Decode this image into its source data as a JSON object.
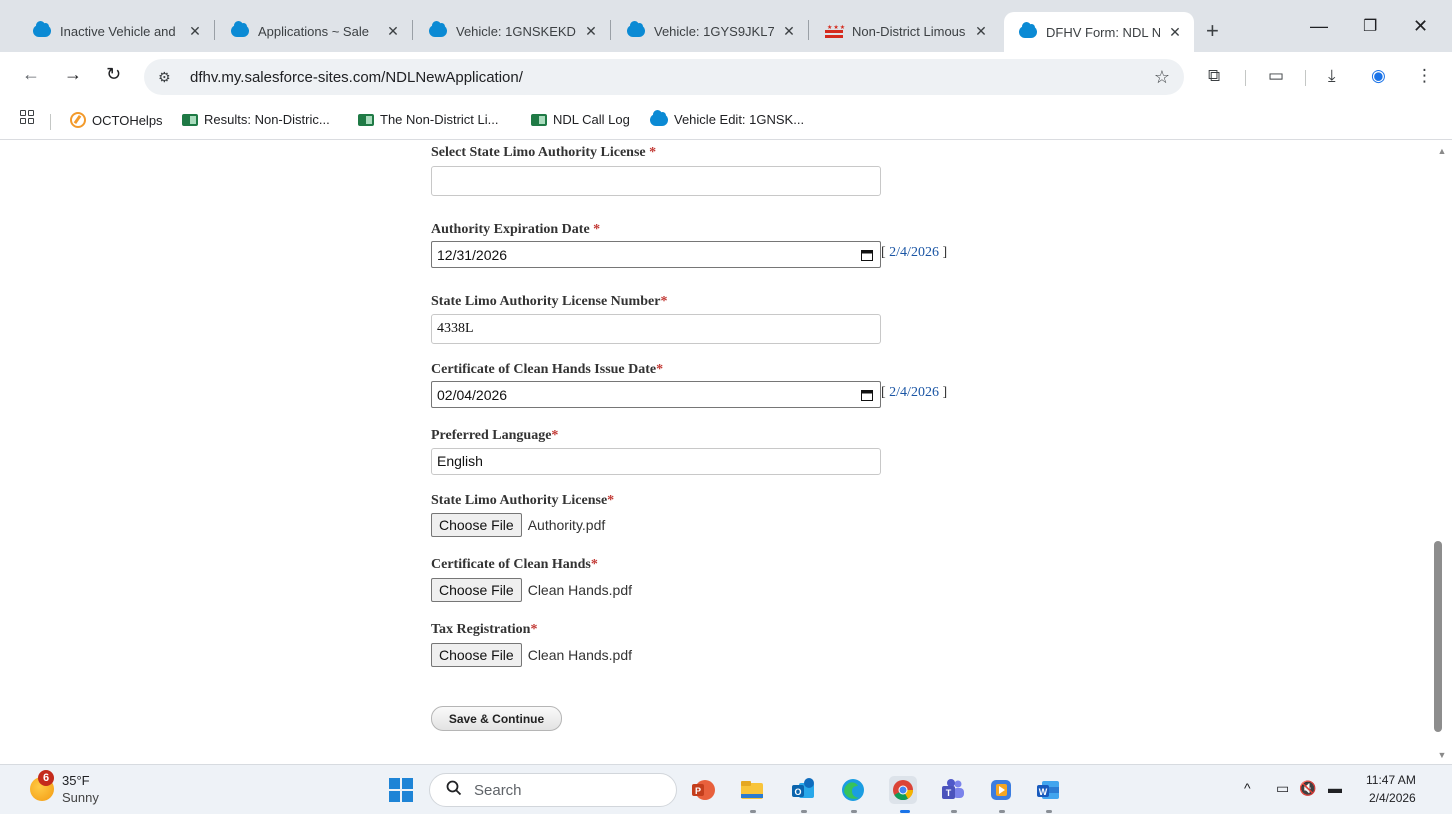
{
  "browser": {
    "tabs": [
      {
        "title": "Inactive Vehicle and",
        "icon": "salesforce-cloud-icon"
      },
      {
        "title": "Applications ~ Sale",
        "icon": "salesforce-cloud-icon"
      },
      {
        "title": "Vehicle: 1GNSKEKD",
        "icon": "salesforce-cloud-icon"
      },
      {
        "title": "Vehicle: 1GYS9JKL7",
        "icon": "salesforce-cloud-icon"
      },
      {
        "title": "Non-District Limous",
        "icon": "dc-flag-icon"
      },
      {
        "title": "DFHV Form: NDL N",
        "icon": "salesforce-cloud-icon",
        "active": true
      }
    ],
    "url": "dfhv.my.salesforce-sites.com/NDLNewApplication/",
    "bookmarks": [
      {
        "label": "OCTOHelps",
        "icon": "octo-icon"
      },
      {
        "label": "Results: Non-Distric...",
        "icon": "sheet-icon"
      },
      {
        "label": "The Non-District Li...",
        "icon": "sheet-icon"
      },
      {
        "label": "NDL Call Log",
        "icon": "sheet-icon"
      },
      {
        "label": "Vehicle Edit: 1GNSK...",
        "icon": "salesforce-cloud-icon"
      }
    ]
  },
  "form": {
    "state_license_select": {
      "label": "Select State Limo Authority License ",
      "required": "*",
      "value": ""
    },
    "authority_expiration": {
      "label": "Authority Expiration Date ",
      "required": "*",
      "value": "12/31/2026",
      "today": "2/4/2026"
    },
    "license_number": {
      "label": "State Limo Authority License Number",
      "required": "*",
      "value": "4338L"
    },
    "clean_hands_date": {
      "label": "Certificate of Clean Hands Issue Date",
      "required": "*",
      "value": "02/04/2026",
      "today": "2/4/2026"
    },
    "preferred_language": {
      "label": "Preferred Language",
      "required": "*",
      "value": "English"
    },
    "license_file": {
      "label": "State Limo Authority License",
      "required": "*",
      "button": "Choose File",
      "filename": "Authority.pdf"
    },
    "clean_hands_file": {
      "label": "Certificate of Clean Hands",
      "required": "*",
      "button": "Choose File",
      "filename": "Clean Hands.pdf"
    },
    "tax_file": {
      "label": "Tax Registration",
      "required": "*",
      "button": "Choose File",
      "filename": "Clean Hands.pdf"
    },
    "submit": "Save & Continue",
    "today_open": "[ ",
    "today_close": " ]"
  },
  "taskbar": {
    "weather": {
      "badge": "6",
      "temp": "35°F",
      "desc": "Sunny"
    },
    "search_placeholder": "Search",
    "clock": {
      "time": "11:47 AM",
      "date": "2/4/2026"
    }
  },
  "colors": {
    "accent": "#0b8ad4",
    "required": "#c23934",
    "link": "#1a55a4"
  }
}
